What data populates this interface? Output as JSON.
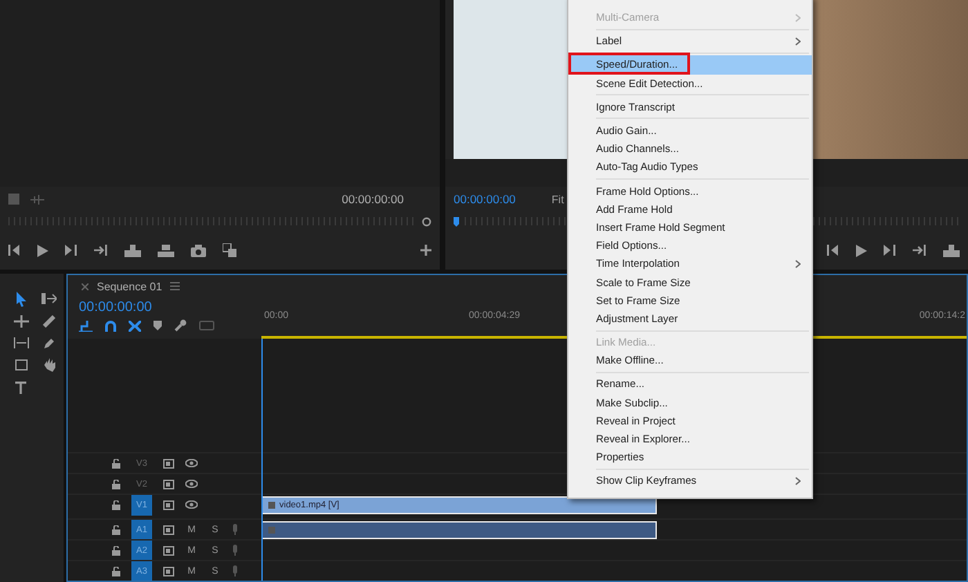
{
  "source_monitor": {
    "timecode": "00:00:00:00"
  },
  "program_monitor": {
    "timecode": "00:00:00:00",
    "zoom": "Fit"
  },
  "timeline": {
    "tab": "Sequence 01",
    "timecode": "00:00:00:00",
    "ruler_labels": [
      "00:00",
      "00:00:04:29",
      "00:00:14:2"
    ],
    "tracks": [
      {
        "label": "V3",
        "kind": "video",
        "targeted": false
      },
      {
        "label": "V2",
        "kind": "video",
        "targeted": false
      },
      {
        "label": "V1",
        "kind": "video",
        "targeted": true
      },
      {
        "label": "A1",
        "kind": "audio",
        "targeted": true,
        "buttons": [
          "M",
          "S"
        ]
      },
      {
        "label": "A2",
        "kind": "audio",
        "targeted": true,
        "buttons": [
          "M",
          "S"
        ]
      },
      {
        "label": "A3",
        "kind": "audio",
        "targeted": true,
        "buttons": [
          "M",
          "S"
        ]
      }
    ],
    "clips": [
      {
        "kind": "video",
        "label": "video1.mp4 [V]"
      },
      {
        "kind": "audio"
      }
    ]
  },
  "context_menu": {
    "items": [
      {
        "kind": "item",
        "label": "Multi-Camera",
        "disabled": true,
        "submenu": true,
        "selected": false,
        "annotated": false
      },
      {
        "kind": "separator"
      },
      {
        "kind": "item",
        "label": "Label",
        "disabled": false,
        "submenu": true,
        "selected": false,
        "annotated": false
      },
      {
        "kind": "separator"
      },
      {
        "kind": "item",
        "label": "Speed/Duration...",
        "disabled": false,
        "submenu": false,
        "selected": true,
        "annotated": true
      },
      {
        "kind": "item",
        "label": "Scene Edit Detection...",
        "disabled": false,
        "submenu": false,
        "selected": false,
        "annotated": false
      },
      {
        "kind": "separator"
      },
      {
        "kind": "item",
        "label": "Ignore Transcript",
        "disabled": false,
        "submenu": false,
        "selected": false,
        "annotated": false
      },
      {
        "kind": "separator"
      },
      {
        "kind": "item",
        "label": "Audio Gain...",
        "disabled": false,
        "submenu": false,
        "selected": false,
        "annotated": false
      },
      {
        "kind": "item",
        "label": "Audio Channels...",
        "disabled": false,
        "submenu": false,
        "selected": false,
        "annotated": false
      },
      {
        "kind": "item",
        "label": "Auto-Tag Audio Types",
        "disabled": false,
        "submenu": false,
        "selected": false,
        "annotated": false
      },
      {
        "kind": "separator"
      },
      {
        "kind": "item",
        "label": "Frame Hold Options...",
        "disabled": false,
        "submenu": false,
        "selected": false,
        "annotated": false
      },
      {
        "kind": "item",
        "label": "Add Frame Hold",
        "disabled": false,
        "submenu": false,
        "selected": false,
        "annotated": false
      },
      {
        "kind": "item",
        "label": "Insert Frame Hold Segment",
        "disabled": false,
        "submenu": false,
        "selected": false,
        "annotated": false
      },
      {
        "kind": "item",
        "label": "Field Options...",
        "disabled": false,
        "submenu": false,
        "selected": false,
        "annotated": false
      },
      {
        "kind": "item",
        "label": "Time Interpolation",
        "disabled": false,
        "submenu": true,
        "selected": false,
        "annotated": false
      },
      {
        "kind": "item",
        "label": "Scale to Frame Size",
        "disabled": false,
        "submenu": false,
        "selected": false,
        "annotated": false
      },
      {
        "kind": "item",
        "label": "Set to Frame Size",
        "disabled": false,
        "submenu": false,
        "selected": false,
        "annotated": false
      },
      {
        "kind": "item",
        "label": "Adjustment Layer",
        "disabled": false,
        "submenu": false,
        "selected": false,
        "annotated": false
      },
      {
        "kind": "separator"
      },
      {
        "kind": "item",
        "label": "Link Media...",
        "disabled": true,
        "submenu": false,
        "selected": false,
        "annotated": false
      },
      {
        "kind": "item",
        "label": "Make Offline...",
        "disabled": false,
        "submenu": false,
        "selected": false,
        "annotated": false
      },
      {
        "kind": "separator"
      },
      {
        "kind": "item",
        "label": "Rename...",
        "disabled": false,
        "submenu": false,
        "selected": false,
        "annotated": false
      },
      {
        "kind": "item",
        "label": "Make Subclip...",
        "disabled": false,
        "submenu": false,
        "selected": false,
        "annotated": false
      },
      {
        "kind": "item",
        "label": "Reveal in Project",
        "disabled": false,
        "submenu": false,
        "selected": false,
        "annotated": false
      },
      {
        "kind": "item",
        "label": "Reveal in Explorer...",
        "disabled": false,
        "submenu": false,
        "selected": false,
        "annotated": false
      },
      {
        "kind": "item",
        "label": "Properties",
        "disabled": false,
        "submenu": false,
        "selected": false,
        "annotated": false
      },
      {
        "kind": "separator"
      },
      {
        "kind": "item",
        "label": "Show Clip Keyframes",
        "disabled": false,
        "submenu": true,
        "selected": false,
        "annotated": false
      }
    ]
  }
}
